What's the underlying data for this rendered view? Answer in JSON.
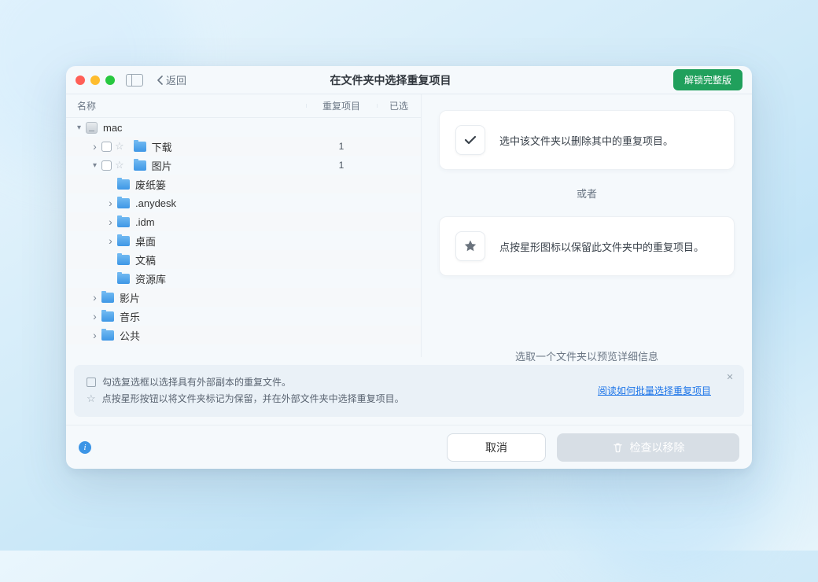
{
  "titlebar": {
    "back": "返回",
    "title": "在文件夹中选择重复项目",
    "unlock": "解锁完整版"
  },
  "columns": {
    "name": "名称",
    "duplicates": "重复项目",
    "selected": "已选"
  },
  "tree": [
    {
      "indent": 0,
      "chev": "down",
      "cb": false,
      "star": false,
      "icon": "hd",
      "name": "mac",
      "dup": "",
      "stripe": false
    },
    {
      "indent": 1,
      "chev": "right",
      "cb": true,
      "star": true,
      "icon": "fld",
      "name": "下载",
      "dup": "1",
      "stripe": true
    },
    {
      "indent": 1,
      "chev": "down",
      "cb": true,
      "star": true,
      "icon": "fld",
      "name": "图片",
      "dup": "1",
      "stripe": false
    },
    {
      "indent": 2,
      "chev": "none",
      "cb": false,
      "star": false,
      "icon": "fld",
      "name": "废纸篓",
      "dup": "",
      "stripe": true
    },
    {
      "indent": 2,
      "chev": "right",
      "cb": false,
      "star": false,
      "icon": "fld",
      "name": ".anydesk",
      "dup": "",
      "stripe": false
    },
    {
      "indent": 2,
      "chev": "right",
      "cb": false,
      "star": false,
      "icon": "fld",
      "name": ".idm",
      "dup": "",
      "stripe": true
    },
    {
      "indent": 2,
      "chev": "right",
      "cb": false,
      "star": false,
      "icon": "fld",
      "name": "桌面",
      "dup": "",
      "stripe": false
    },
    {
      "indent": 2,
      "chev": "none",
      "cb": false,
      "star": false,
      "icon": "fld",
      "name": "文稿",
      "dup": "",
      "stripe": true
    },
    {
      "indent": 2,
      "chev": "none",
      "cb": false,
      "star": false,
      "icon": "fld",
      "name": "资源库",
      "dup": "",
      "stripe": false
    },
    {
      "indent": 1,
      "chev": "right",
      "cb": false,
      "star": false,
      "icon": "fld",
      "name": "影片",
      "dup": "",
      "stripe": true
    },
    {
      "indent": 1,
      "chev": "right",
      "cb": false,
      "star": false,
      "icon": "fld",
      "name": "音乐",
      "dup": "",
      "stripe": false
    },
    {
      "indent": 1,
      "chev": "right",
      "cb": false,
      "star": false,
      "icon": "fld",
      "name": "公共",
      "dup": "",
      "stripe": true
    }
  ],
  "cards": {
    "check": "选中该文件夹以删除其中的重复项目。",
    "or": "或者",
    "star": "点按星形图标以保留此文件夹中的重复项目。"
  },
  "preview_hint": "选取一个文件夹以预览详细信息",
  "tip": {
    "line1": "勾选复选框以选择具有外部副本的重复文件。",
    "line2": "点按星形按钮以将文件夹标记为保留，并在外部文件夹中选择重复项目。",
    "link": "阅读如何批量选择重复项目"
  },
  "footer": {
    "cancel": "取消",
    "remove": "检查以移除"
  }
}
